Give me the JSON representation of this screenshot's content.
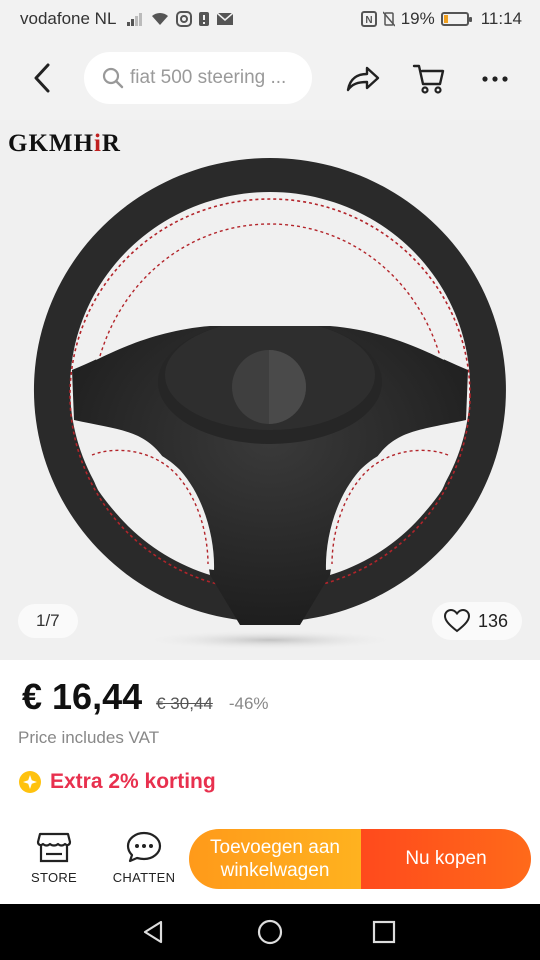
{
  "status_bar": {
    "carrier": "vodafone NL",
    "battery_percent": "19%",
    "battery_level": 0.19,
    "time": "11:14"
  },
  "top_nav": {
    "search_query": "fiat 500 steering ..."
  },
  "product": {
    "brand": "GKMHiR",
    "image_index": "1/7",
    "likes": "136",
    "price": "€ 16,44",
    "original_price": "€ 30,44",
    "discount": "-46%",
    "vat_note": "Price includes VAT",
    "promo": "Extra 2% korting"
  },
  "actions": {
    "store_label": "STORE",
    "chat_label": "CHATTEN",
    "add_to_cart_label": "Toevoegen aan winkelwagen",
    "buy_now_label": "Nu kopen"
  },
  "colors": {
    "promo_red": "#e8304e",
    "cart_orange": "#ffa01c",
    "buy_orange": "#ff4a1c",
    "stitch_red": "#b3242a"
  }
}
